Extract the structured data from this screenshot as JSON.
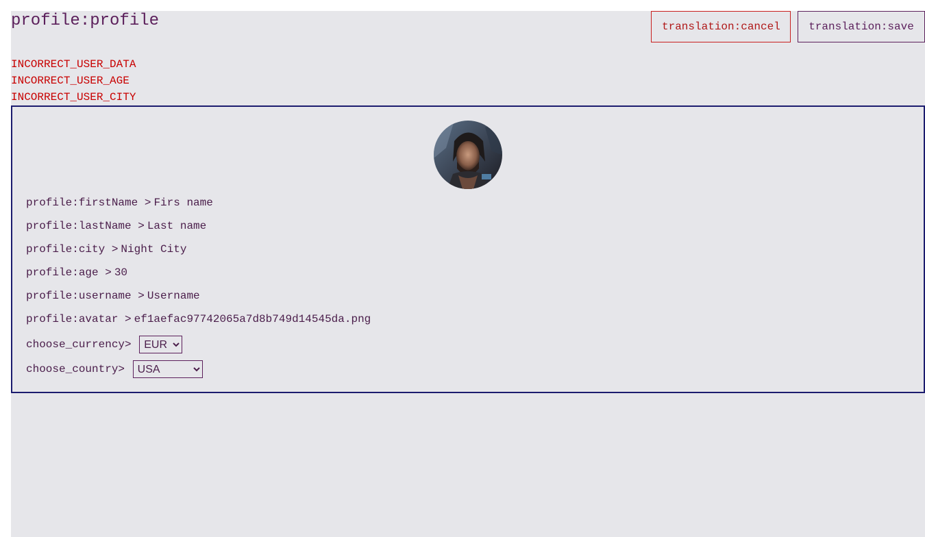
{
  "header": {
    "title": "profile:profile",
    "cancel_label": "translation:cancel",
    "save_label": "translation:save"
  },
  "errors": [
    "INCORRECT_USER_DATA",
    "INCORRECT_USER_AGE",
    "INCORRECT_USER_CITY"
  ],
  "card": {
    "avatar_alt": "avatar",
    "fields": [
      {
        "label": "profile:firstName >",
        "value": "Firs name"
      },
      {
        "label": "profile:lastName >",
        "value": "Last name"
      },
      {
        "label": "profile:city >",
        "value": "Night City"
      },
      {
        "label": "profile:age >",
        "value": "30"
      },
      {
        "label": "profile:username >",
        "value": "Username"
      },
      {
        "label": "profile:avatar >",
        "value": "ef1aefac97742065a7d8b749d14545da.png"
      }
    ],
    "currency": {
      "label": "choose_currency>",
      "selected": "EUR"
    },
    "country": {
      "label": "choose_country>",
      "selected": "USA"
    }
  },
  "colors": {
    "page_bg": "#e6e6ea",
    "text": "#4a1d4a",
    "error": "#c80000",
    "card_border": "#1b1b6e",
    "cancel_border": "#c81d1d"
  }
}
